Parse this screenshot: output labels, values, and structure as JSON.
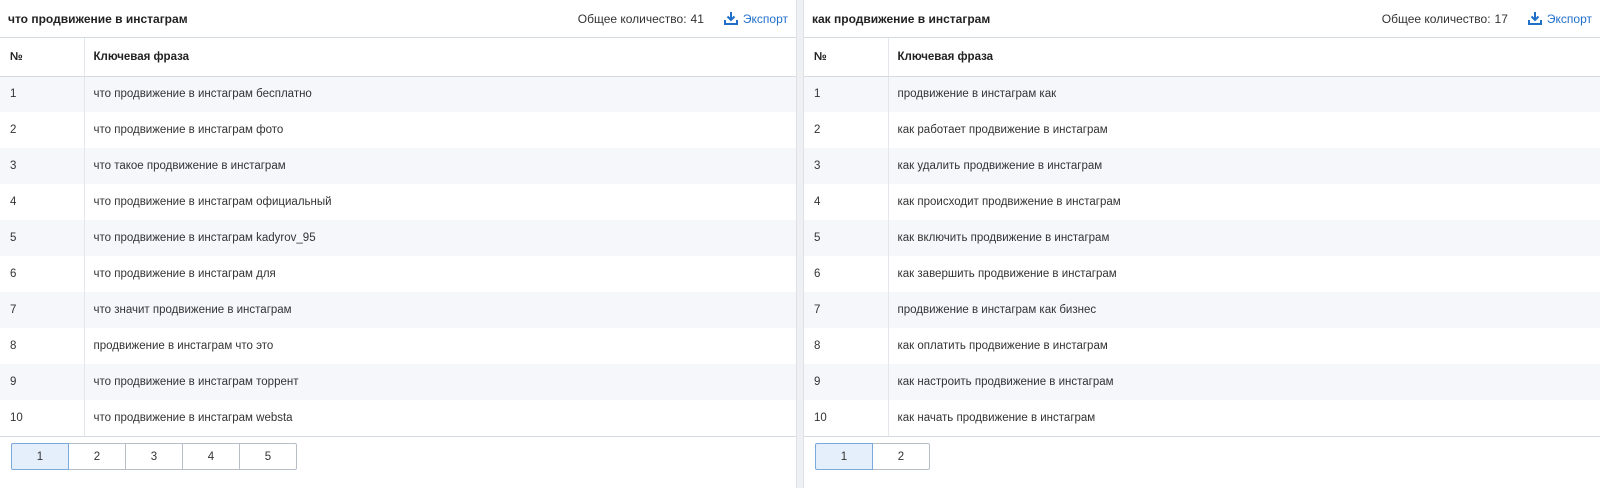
{
  "colors": {
    "accent": "#1f6fc9",
    "active_page_bg": "#e4effb",
    "stripe": "#f5f7fb"
  },
  "export_icon": "download-icon",
  "panels": [
    {
      "title": "что продвижение в инстаграм",
      "total_label": "Общее количество:",
      "total_value": "41",
      "export_label": "Экспорт",
      "headers": {
        "num": "№",
        "phrase": "Ключевая фраза"
      },
      "rows": [
        {
          "num": "1",
          "phrase": "что продвижение в инстаграм бесплатно"
        },
        {
          "num": "2",
          "phrase": "что продвижение в инстаграм фото"
        },
        {
          "num": "3",
          "phrase": "что такое продвижение в инстаграм"
        },
        {
          "num": "4",
          "phrase": "что продвижение в инстаграм официальный"
        },
        {
          "num": "5",
          "phrase": "что продвижение в инстаграм kadyrov_95"
        },
        {
          "num": "6",
          "phrase": "что продвижение в инстаграм для"
        },
        {
          "num": "7",
          "phrase": "что значит продвижение в инстаграм"
        },
        {
          "num": "8",
          "phrase": "продвижение в инстаграм что это"
        },
        {
          "num": "9",
          "phrase": "что продвижение в инстаграм торрент"
        },
        {
          "num": "10",
          "phrase": "что продвижение в инстаграм websta"
        }
      ],
      "pages": [
        "1",
        "2",
        "3",
        "4",
        "5"
      ],
      "current_page": "1"
    },
    {
      "title": "как продвижение в инстаграм",
      "total_label": "Общее количество:",
      "total_value": "17",
      "export_label": "Экспорт",
      "headers": {
        "num": "№",
        "phrase": "Ключевая фраза"
      },
      "rows": [
        {
          "num": "1",
          "phrase": "продвижение в инстаграм как"
        },
        {
          "num": "2",
          "phrase": "как работает продвижение в инстаграм"
        },
        {
          "num": "3",
          "phrase": "как удалить продвижение в инстаграм"
        },
        {
          "num": "4",
          "phrase": "как происходит продвижение в инстаграм"
        },
        {
          "num": "5",
          "phrase": "как включить продвижение в инстаграм"
        },
        {
          "num": "6",
          "phrase": "как завершить продвижение в инстаграм"
        },
        {
          "num": "7",
          "phrase": "продвижение в инстаграм как бизнес"
        },
        {
          "num": "8",
          "phrase": "как оплатить продвижение в инстаграм"
        },
        {
          "num": "9",
          "phrase": "как настроить продвижение в инстаграм"
        },
        {
          "num": "10",
          "phrase": "как начать продвижение в инстаграм"
        }
      ],
      "pages": [
        "1",
        "2"
      ],
      "current_page": "1"
    }
  ]
}
